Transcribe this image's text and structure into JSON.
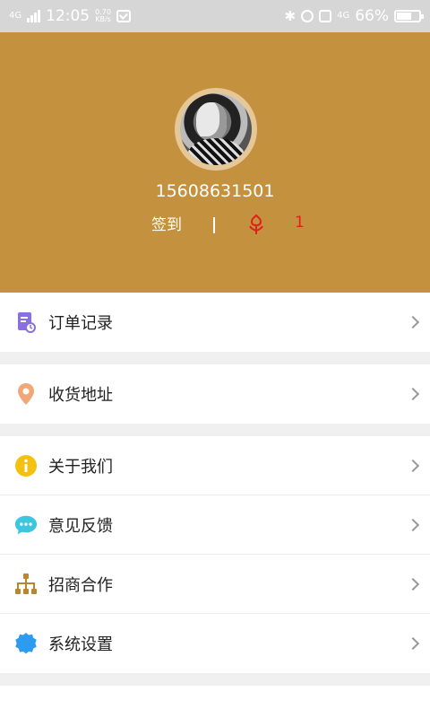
{
  "status_bar": {
    "network": "4G",
    "time": "12:05",
    "speed_value": "0.70",
    "speed_unit": "KB/s",
    "network_right": "4G",
    "battery": "66%"
  },
  "profile": {
    "phone": "15608631501",
    "signin_label": "签到",
    "divider": "|",
    "flower_count": "1"
  },
  "menu": [
    {
      "label": "订单记录",
      "icon": "order-record-icon",
      "color": "#8a6fe0"
    },
    {
      "label": "收货地址",
      "icon": "location-pin-icon",
      "color": "#f0a878"
    },
    {
      "label": "关于我们",
      "icon": "info-icon",
      "color": "#f4c10f"
    },
    {
      "label": "意见反馈",
      "icon": "chat-bubble-icon",
      "color": "#3cc6e0"
    },
    {
      "label": "招商合作",
      "icon": "org-chart-icon",
      "color": "#b8862e"
    },
    {
      "label": "系统设置",
      "icon": "gear-icon",
      "color": "#2d9bf0"
    }
  ],
  "colors": {
    "header_bg": "#c4923e",
    "accent_red": "#e0201a",
    "status_bg": "#d6d6d6"
  }
}
